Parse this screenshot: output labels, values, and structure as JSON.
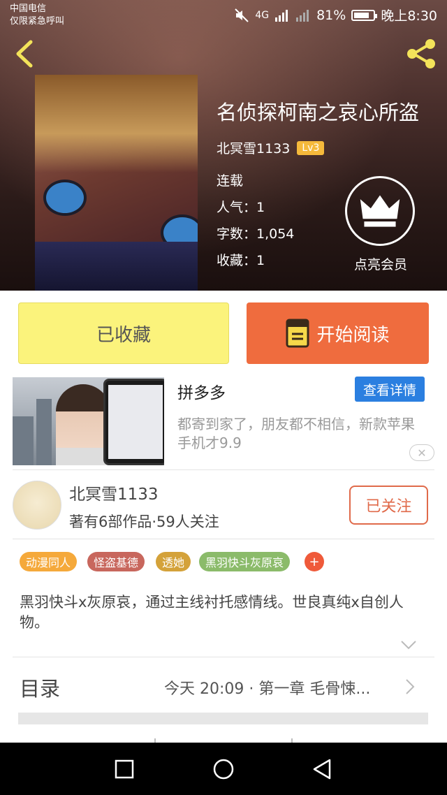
{
  "statusbar": {
    "carrier": "中国电信",
    "carrier_sub": "仅限紧急呼叫",
    "network": "4G",
    "battery": "81%",
    "battery_level": 0.81,
    "time": "晚上8:30"
  },
  "book": {
    "title": "名侦探柯南之哀心所盗",
    "author": "北冥雪1133",
    "level": "Lv3",
    "status": "连载",
    "popularity": "人气：1",
    "word_count": "字数：1,054",
    "favorites": "收藏：1",
    "vip_label": "点亮会员"
  },
  "actions": {
    "favorited_label": "已收藏",
    "read_label": "开始阅读"
  },
  "ad": {
    "title": "拼多多",
    "detail_label": "查看详情",
    "description": "都寄到家了，朋友都不相信，新款苹果手机才9.9",
    "close_glyph": "✕"
  },
  "author_card": {
    "name": "北冥雪1133",
    "subtitle": "著有6部作品·59人关注",
    "follow_label": "已关注"
  },
  "tags": [
    {
      "label": "动漫同人",
      "color": "#f5a93b"
    },
    {
      "label": "怪盗基德",
      "color": "#c8675d"
    },
    {
      "label": "透她",
      "color": "#d4a23a"
    },
    {
      "label": "黑羽快斗灰原哀",
      "color": "#8bbb6a"
    }
  ],
  "tag_add": "+",
  "synopsis": "黑羽快斗x灰原哀，通过主线衬托感情线。世良真纯x自创人物。",
  "toc": {
    "label": "目录",
    "latest": "今天 20:09 · 第一章 毛骨悚..."
  },
  "colors": {
    "accent_orange": "#ef6c3e",
    "favorited_yellow": "#fbf37c",
    "detail_blue": "#2b7fe0",
    "follow_red": "#e06a4a"
  }
}
